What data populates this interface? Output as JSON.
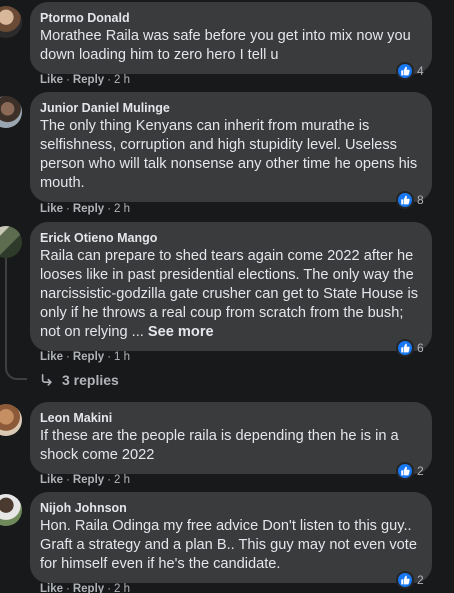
{
  "comments": [
    {
      "author": "Ptormo Donald",
      "text": "Morathee Raila was safe before you get into mix now you down loading him to zero hero I tell u",
      "like": "Like",
      "reply": "Reply",
      "time": "2 h",
      "reaction_count": "4"
    },
    {
      "author": "Junior Daniel Mulinge",
      "text": "The only thing Kenyans can inherit from murathe is selfishness, corruption and high stupidity level. Useless person who will talk nonsense any other time he opens his mouth.",
      "like": "Like",
      "reply": "Reply",
      "time": "2 h",
      "reaction_count": "8"
    },
    {
      "author": "Erick Otieno Mango",
      "text": "Raila can prepare to shed tears again come 2022 after he looses like in past presidential elections. The only way the narcissistic-godzilla gate crusher can get to State House is only if he throws a real coup from scratch from the bush; not on relying ...",
      "see_more": "See more",
      "like": "Like",
      "reply": "Reply",
      "time": "1 h",
      "reaction_count": "6",
      "replies_label": "3 replies"
    },
    {
      "author": "Leon Makini",
      "text": "If these are the people raila is depending then he is in a shock come 2022",
      "like": "Like",
      "reply": "Reply",
      "time": "2 h",
      "reaction_count": "2"
    },
    {
      "author": "Nijoh Johnson",
      "text": "Hon. Raila Odinga my free advice Don't listen to this guy.. Graft a strategy and a plan B.. This guy may not even vote for himself even if he's the candidate.",
      "like": "Like",
      "reply": "Reply",
      "time": "2 h",
      "reaction_count": "2"
    }
  ],
  "icons": {
    "like_badge": "thumbs-up-icon",
    "replies": "reply-arrow-icon"
  },
  "colors": {
    "background": "#18191a",
    "bubble": "#3a3b3c",
    "like_blue": "#1877f2",
    "meta_text": "#b0b3b8"
  }
}
